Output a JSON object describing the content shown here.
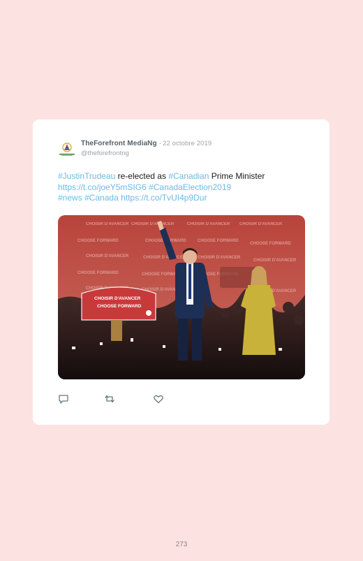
{
  "tweet": {
    "display_name": "TheForefront MediaNg",
    "separator": "·",
    "date": "22 octobre 2019",
    "handle": "@theforefrontng",
    "line1": [
      {
        "text": "#JustinTrudeau",
        "link": true
      },
      {
        "text": " re-elected as ",
        "link": false
      },
      {
        "text": "#Canadian",
        "link": true
      },
      {
        "text": " Prime Minister",
        "link": false
      }
    ],
    "line2": [
      {
        "text": "https://t.co/joeY5mSIG6",
        "link": true
      },
      {
        "text": " ",
        "link": false
      },
      {
        "text": "#CanadaElection2019",
        "link": true
      }
    ],
    "line3": [
      {
        "text": "#news",
        "link": true
      },
      {
        "text": " ",
        "link": false
      },
      {
        "text": "#Canada",
        "link": true
      },
      {
        "text": " ",
        "link": false
      },
      {
        "text": "https://t.co/TvUI4p9Dur",
        "link": true
      }
    ],
    "photo": {
      "podium_line1": "CHOISIR D'AVANCER",
      "podium_line2": "CHOOSE FORWARD",
      "backdrop_fr": "CHOISIR D'AVANCER",
      "backdrop_en": "CHOOSE FORWARD"
    }
  },
  "actions": {
    "reply_icon": "reply-icon",
    "retweet_icon": "retweet-icon",
    "like_icon": "like-icon"
  },
  "colors": {
    "page_background": "#fde2e2",
    "link": "#6bb9e3",
    "backdrop_red": "#b3413b"
  },
  "page_number": "273"
}
